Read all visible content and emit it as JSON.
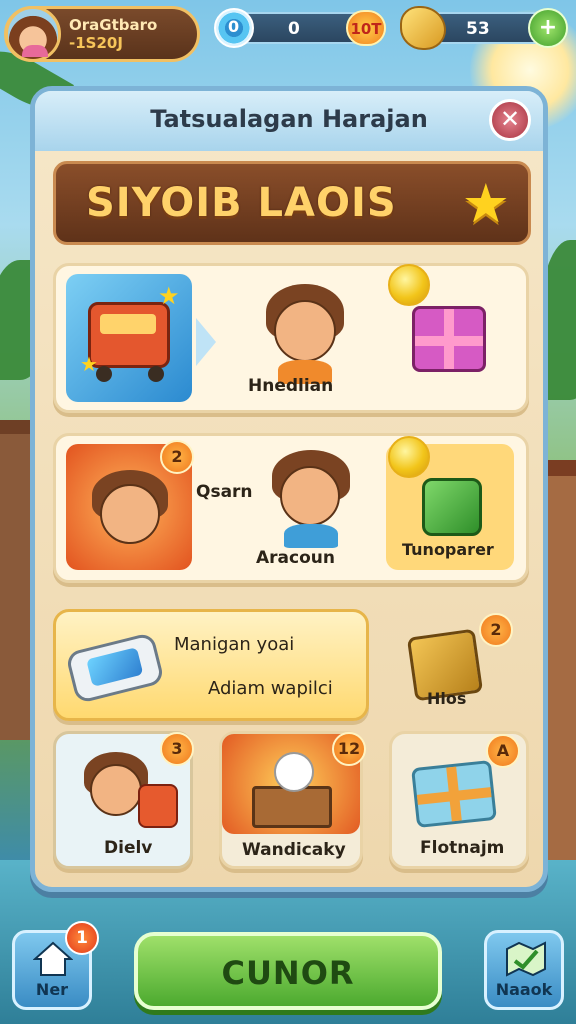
{
  "hud": {
    "player_name": "OraGtbaro",
    "player_sub": "-1S20J",
    "coin_value": "0",
    "coin_badge": "10T",
    "gold_value": "53"
  },
  "panel": {
    "title": "Tatsualagan Harajan",
    "close": "✕",
    "banner_text": "SIYOIB LAOIS",
    "banner_star": "★"
  },
  "cards": {
    "row1": {
      "label": "Hnedlian"
    },
    "row2": {
      "thumb_badge": "2",
      "side_label": "Qsarn",
      "center_label": "Aracoun",
      "right_label": "Tunoparer"
    },
    "row3": {
      "title": "Manigan yoai",
      "subtitle": "Adiam wapilci",
      "right_badge": "2",
      "right_label": "Hlos"
    },
    "row4": [
      {
        "badge": "3",
        "label": "Dielv"
      },
      {
        "badge": "12",
        "label": "Wandicaky"
      },
      {
        "badge": "A",
        "label": "Flotnajm"
      }
    ]
  },
  "bottom": {
    "home_label": "Ner",
    "home_badge": "1",
    "go_label": "CUNOR",
    "map_label": "Naaok"
  },
  "colors": {
    "panel_border": "#7db3d6",
    "banner_bg": "#6e3b1f",
    "banner_text": "#ffd26a",
    "go_button": "#5cb834"
  }
}
